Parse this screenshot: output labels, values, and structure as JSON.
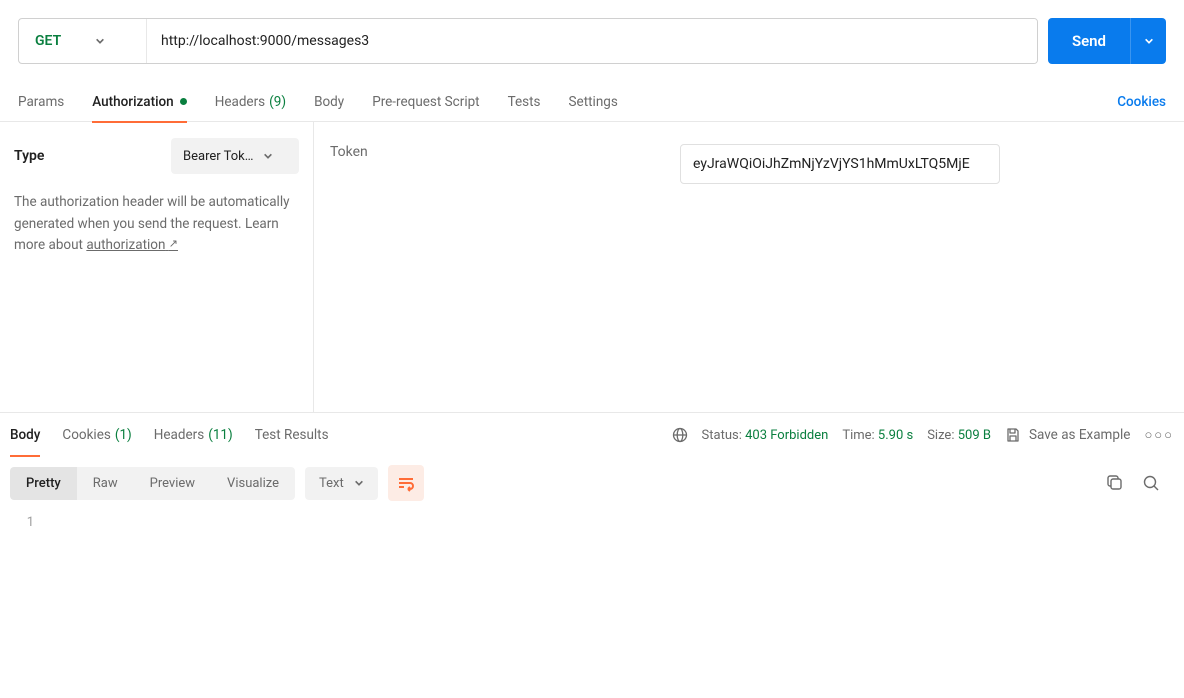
{
  "request": {
    "method": "GET",
    "url": "http://localhost:9000/messages3",
    "send_label": "Send"
  },
  "tabs": {
    "params": "Params",
    "authorization": "Authorization",
    "headers": "Headers",
    "headers_count": "(9)",
    "body": "Body",
    "pre_request": "Pre-request Script",
    "tests": "Tests",
    "settings": "Settings",
    "cookies": "Cookies"
  },
  "auth": {
    "type_label": "Type",
    "type_value": "Bearer Tok…",
    "description_1": "The authorization header will be automatically generated when you send the request. Learn more about ",
    "link_text": "authorization",
    "token_label": "Token",
    "token_value": "eyJraWQiOiJhZmNjYzVjYS1hMmUxLTQ5MjE"
  },
  "response": {
    "tabs": {
      "body": "Body",
      "cookies": "Cookies",
      "cookies_count": "(1)",
      "headers": "Headers",
      "headers_count": "(11)",
      "test_results": "Test Results"
    },
    "status_label": "Status:",
    "status_value": "403 Forbidden",
    "time_label": "Time:",
    "time_value": "5.90 s",
    "size_label": "Size:",
    "size_value": "509 B",
    "save_example": "Save as Example",
    "view": {
      "pretty": "Pretty",
      "raw": "Raw",
      "preview": "Preview",
      "visualize": "Visualize",
      "format": "Text"
    },
    "editor": {
      "line_number": "1",
      "content": ""
    }
  }
}
